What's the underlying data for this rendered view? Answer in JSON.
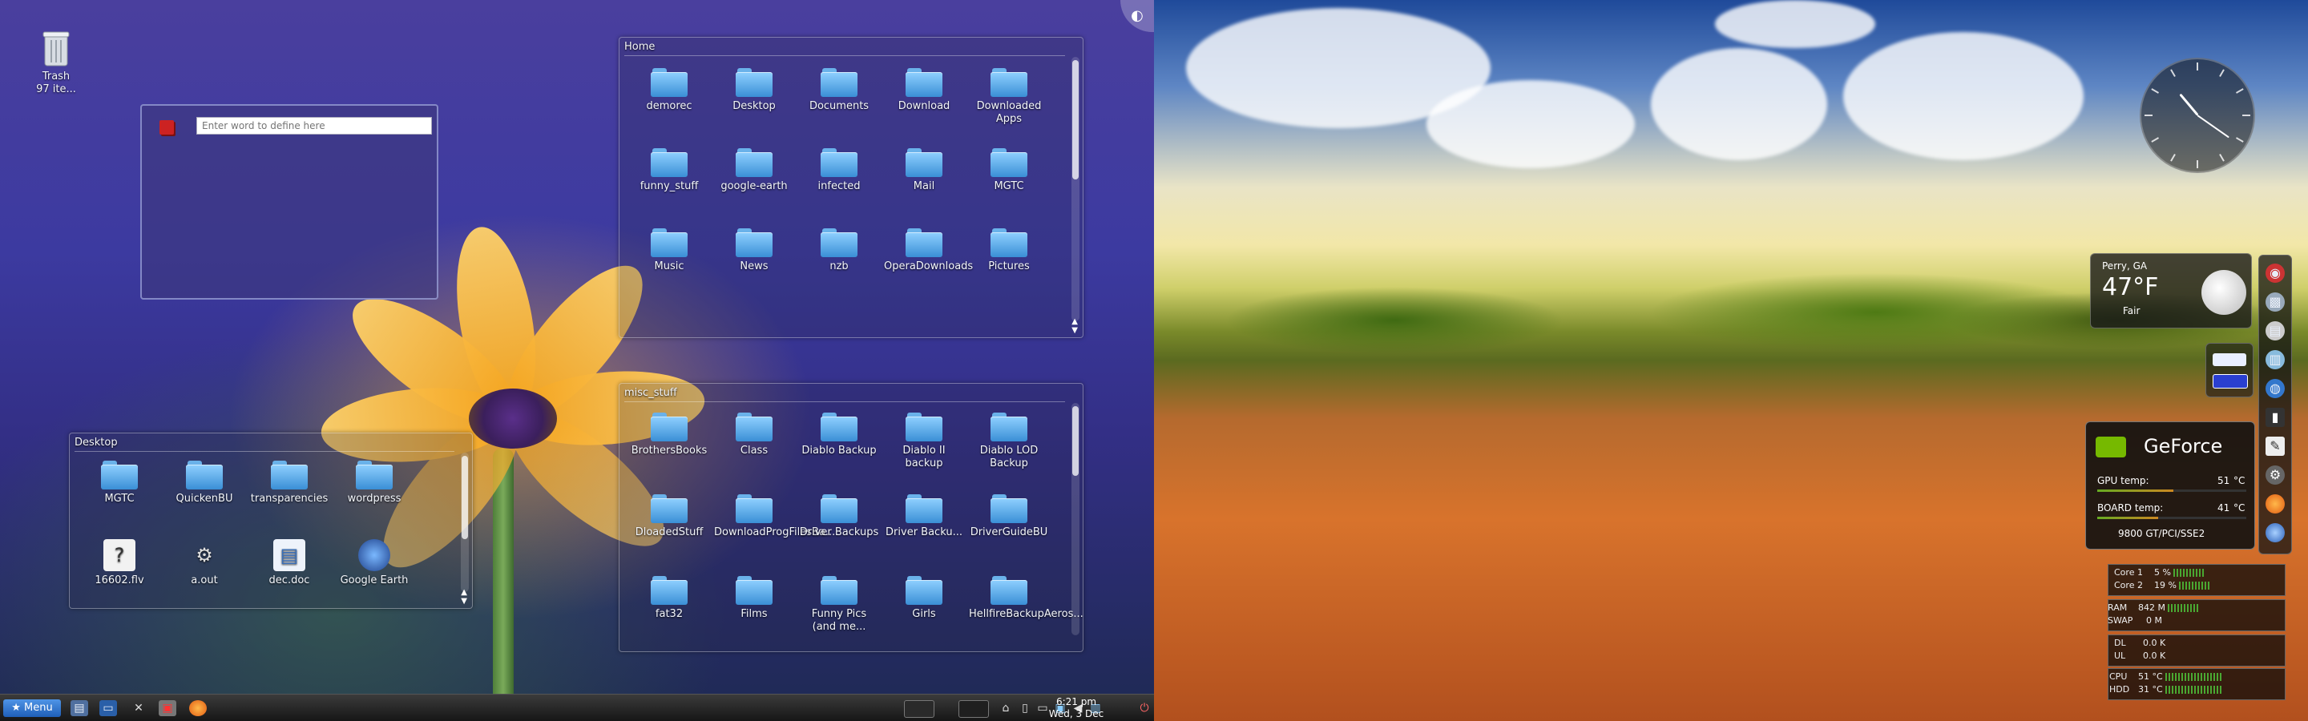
{
  "desktop": {
    "trash": {
      "label": "Trash",
      "count": "97 ite..."
    }
  },
  "dictionary": {
    "placeholder": "Enter word to define here"
  },
  "home_view": {
    "title": "Home",
    "items": [
      {
        "label": "demorec",
        "badge": ""
      },
      {
        "label": "Desktop",
        "badge": "desktop"
      },
      {
        "label": "Documents",
        "badge": "doc"
      },
      {
        "label": "Download",
        "badge": "down"
      },
      {
        "label": "Downloaded Apps",
        "badge": ""
      },
      {
        "label": "funny_stuff",
        "badge": ""
      },
      {
        "label": "google-earth",
        "badge": ""
      },
      {
        "label": "infected",
        "badge": ""
      },
      {
        "label": "Mail",
        "badge": ""
      },
      {
        "label": "MGTC",
        "badge": ""
      },
      {
        "label": "Music",
        "badge": "music"
      },
      {
        "label": "News",
        "badge": ""
      },
      {
        "label": "nzb",
        "badge": ""
      },
      {
        "label": "OperaDownloads",
        "badge": ""
      },
      {
        "label": "Pictures",
        "badge": "pic"
      }
    ]
  },
  "misc_view": {
    "title": "misc_stuff",
    "items": [
      {
        "label": "BrothersBooks"
      },
      {
        "label": "Class"
      },
      {
        "label": "Diablo Backup"
      },
      {
        "label": "Diablo II backup"
      },
      {
        "label": "Diablo LOD Backup"
      },
      {
        "label": "DloadedStuff"
      },
      {
        "label": "DownloadProgFilesBa..."
      },
      {
        "label": "Driver Backups"
      },
      {
        "label": "Driver Backu..."
      },
      {
        "label": "DriverGuideBU"
      },
      {
        "label": "fat32"
      },
      {
        "label": "Films"
      },
      {
        "label": "Funny Pics (and me..."
      },
      {
        "label": "Girls"
      },
      {
        "label": "HellfireBackupAeros..."
      }
    ]
  },
  "desktop_view": {
    "title": "Desktop",
    "items": [
      {
        "label": "MGTC",
        "kind": "folder"
      },
      {
        "label": "QuickenBU",
        "kind": "folder"
      },
      {
        "label": "transparencies",
        "kind": "folder"
      },
      {
        "label": "wordpress",
        "kind": "folder"
      },
      {
        "label": "16602.flv",
        "kind": "unknown"
      },
      {
        "label": "a.out",
        "kind": "gear"
      },
      {
        "label": "dec.doc",
        "kind": "doc"
      },
      {
        "label": "Google Earth",
        "kind": "earth"
      }
    ]
  },
  "taskbar": {
    "menu_label": "Menu",
    "time": "6:21 pm",
    "date": "Wed, 3 Dec"
  },
  "weather": {
    "location": "Perry, GA",
    "temp": "47°F",
    "condition": "Fair"
  },
  "gpu": {
    "brand": "GeForce",
    "gpu_label": "GPU temp:",
    "gpu_value": "51",
    "board_label": "BOARD temp:",
    "board_value": "41",
    "unit": "°C",
    "model": "9800 GT/PCI/SSE2",
    "gpu_fill": 0.51,
    "board_fill": 0.41
  },
  "sysmon": {
    "core1_label": "Core 1",
    "core1": "5 %",
    "core2_label": "Core 2",
    "core2": "19 %",
    "ram_label": "RAM",
    "ram": "842 M",
    "swap_label": "SWAP",
    "swap": "0 M",
    "dl_label": "DL",
    "dl": "0.0 K",
    "ul_label": "UL",
    "ul": "0.0 K",
    "cpu_label": "CPU",
    "cpu": "51 °C",
    "hdd_label": "HDD",
    "hdd": "31 °C"
  },
  "colors": {
    "accent": "#3a8fd6",
    "gpu_green": "#76b900"
  }
}
